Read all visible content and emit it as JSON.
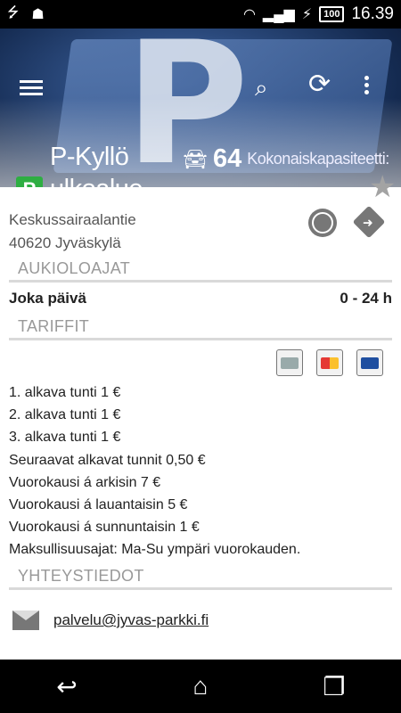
{
  "status_bar": {
    "time": "16.39",
    "battery": "100",
    "icons": [
      "usb-icon",
      "android-icon",
      "wifi-icon",
      "signal-icon",
      "charging-icon",
      "battery-icon"
    ]
  },
  "toolbar": {
    "icons": [
      "menu-icon",
      "search-icon",
      "refresh-icon",
      "overflow-menu-icon"
    ]
  },
  "header": {
    "title": "P-Kyllö",
    "badge": "P",
    "subtitle": "ulkoalue",
    "capacity_value": "64",
    "capacity_label": "Kokonaiskapasiteetti:",
    "badge_color": "#2eae42"
  },
  "address": {
    "street": "Keskussairaalantie",
    "city": "40620 Jyväskylä"
  },
  "sections": {
    "hours_title": "AUKIOLOAJAT",
    "tariffs_title": "TARIFFIT",
    "contact_title": "YHTEYSTIEDOT"
  },
  "hours": {
    "day": "Joka päivä",
    "time": "0 - 24 h"
  },
  "tariffs": [
    "1. alkava tunti 1 €",
    "2. alkava tunti 1 €",
    "3. alkava tunti 1 €",
    "Seuraavat alkavat tunnit 0,50 €",
    "Vuorokausi á arkisin 7 €",
    "Vuorokausi á lauantaisin 5 €",
    "Vuorokausi á sunnuntaisin 1 €",
    "Maksullisuusajat: Ma-Su ympäri vuorokauden."
  ],
  "contact": {
    "email": "palvelu@jyvas-parkki.fi"
  }
}
